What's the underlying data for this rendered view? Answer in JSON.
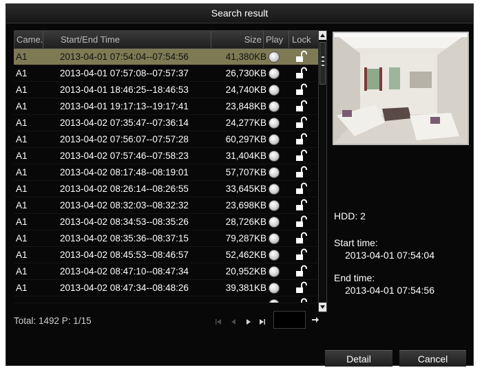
{
  "dialog": {
    "title": "Search result"
  },
  "table": {
    "columns": {
      "camera": "Came...",
      "time": "Start/End Time",
      "size": "Size",
      "play": "Play",
      "lock": "Lock"
    },
    "rows": [
      {
        "camera": "A1",
        "time": "2013-04-01 07:54:04--07:54:56",
        "size": "41,380KB",
        "selected": true
      },
      {
        "camera": "A1",
        "time": "2013-04-01 07:57:08--07:57:37",
        "size": "26,730KB"
      },
      {
        "camera": "A1",
        "time": "2013-04-01 18:46:25--18:46:53",
        "size": "24,740KB"
      },
      {
        "camera": "A1",
        "time": "2013-04-01 19:17:13--19:17:41",
        "size": "23,848KB"
      },
      {
        "camera": "A1",
        "time": "2013-04-02 07:35:47--07:36:14",
        "size": "24,277KB"
      },
      {
        "camera": "A1",
        "time": "2013-04-02 07:56:07--07:57:28",
        "size": "60,297KB"
      },
      {
        "camera": "A1",
        "time": "2013-04-02 07:57:46--07:58:23",
        "size": "31,404KB"
      },
      {
        "camera": "A1",
        "time": "2013-04-02 08:17:48--08:19:01",
        "size": "57,707KB"
      },
      {
        "camera": "A1",
        "time": "2013-04-02 08:26:14--08:26:55",
        "size": "33,645KB"
      },
      {
        "camera": "A1",
        "time": "2013-04-02 08:32:03--08:32:32",
        "size": "23,698KB"
      },
      {
        "camera": "A1",
        "time": "2013-04-02 08:34:53--08:35:26",
        "size": "28,726KB"
      },
      {
        "camera": "A1",
        "time": "2013-04-02 08:35:36--08:37:15",
        "size": "79,287KB"
      },
      {
        "camera": "A1",
        "time": "2013-04-02 08:45:53--08:46:57",
        "size": "52,462KB"
      },
      {
        "camera": "A1",
        "time": "2013-04-02 08:47:10--08:47:34",
        "size": "20,952KB"
      },
      {
        "camera": "A1",
        "time": "2013-04-02 08:47:34--08:48:26",
        "size": "39,381KB"
      }
    ]
  },
  "footer": {
    "total": "Total: 1492  P: 1/15",
    "page_input": ""
  },
  "details": {
    "hdd": "HDD: 2",
    "start_label": "Start time:",
    "start_value": "2013-04-01 07:54:04",
    "end_label": "End time:",
    "end_value": "2013-04-01 07:54:56"
  },
  "buttons": {
    "detail": "Detail",
    "cancel": "Cancel"
  },
  "icons": {
    "play": "play-circle-icon",
    "lock": "unlocked-padlock-icon",
    "first": "first-page-icon",
    "prev": "previous-page-icon",
    "next": "next-page-icon",
    "last": "last-page-icon",
    "go": "go-arrow-icon"
  },
  "colors": {
    "selected_row": "#7e7a54",
    "background": "#080808",
    "text": "#ffffff"
  }
}
